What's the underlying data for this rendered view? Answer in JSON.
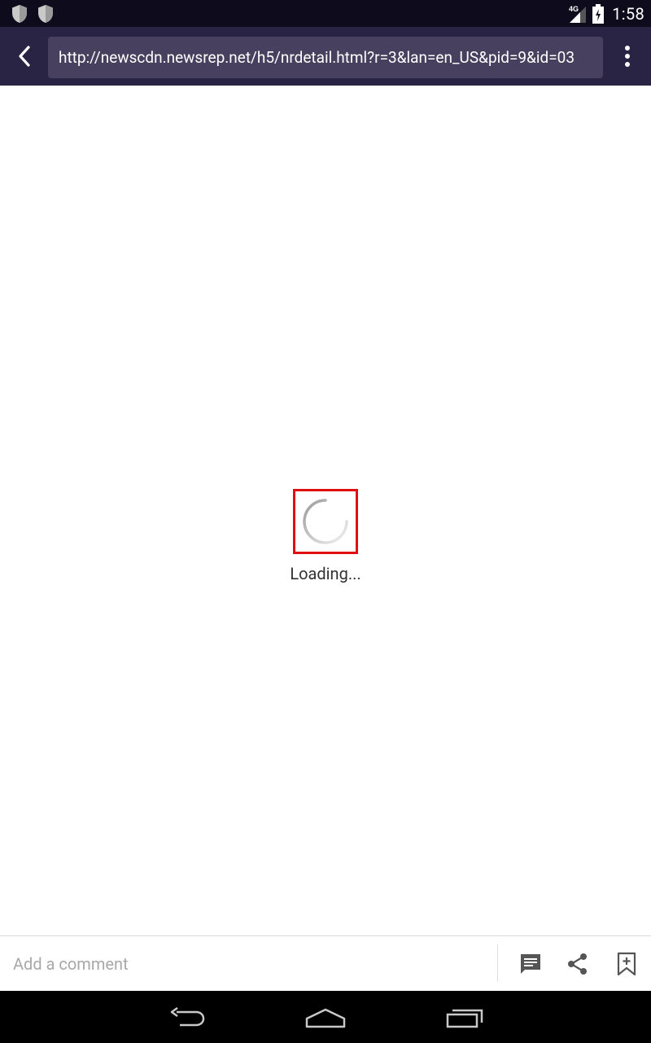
{
  "status_bar": {
    "time": "1:58",
    "network_label": "4G",
    "notification_icons": [
      "shield-icon",
      "shield-icon"
    ]
  },
  "toolbar": {
    "url": "http://newscdn.newsrep.net/h5/nrdetail.html?r=3&lan=en_US&pid=9&id=03"
  },
  "content": {
    "loading_text": "Loading..."
  },
  "comment_bar": {
    "placeholder": "Add a comment",
    "icons": [
      "comment-icon",
      "share-icon",
      "bookmark-add-icon"
    ]
  },
  "nav_bar": {
    "icons": [
      "back-nav-icon",
      "home-nav-icon",
      "recents-nav-icon"
    ]
  },
  "colors": {
    "status_bar_bg": "#0e0b1c",
    "toolbar_bg": "#2a2444",
    "url_field_bg": "#47415f",
    "highlight_border": "#e01010"
  }
}
